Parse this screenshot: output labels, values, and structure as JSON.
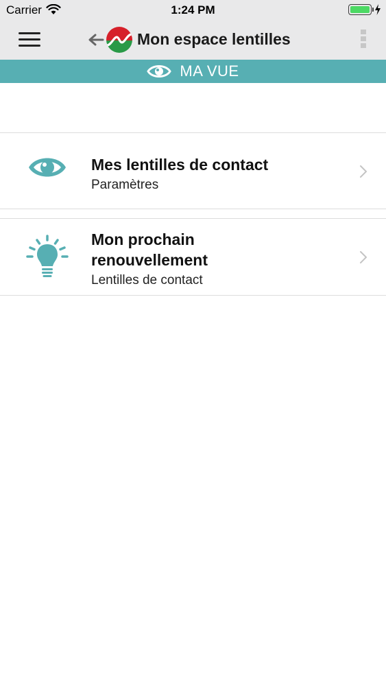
{
  "status_bar": {
    "carrier": "Carrier",
    "time": "1:24 PM",
    "battery_level": 1.0
  },
  "nav": {
    "title": "Mon espace lentilles"
  },
  "section": {
    "title": "MA VUE"
  },
  "items": [
    {
      "title": "Mes lentilles de contact",
      "subtitle": "Paramètres",
      "icon": "eye-icon"
    },
    {
      "title": "Mon prochain renouvellement",
      "subtitle": "Lentilles de contact",
      "icon": "lightbulb-icon"
    }
  ],
  "colors": {
    "accent": "#57afb3",
    "bar_bg": "#e9e9ea",
    "logo_red": "#d6202a",
    "logo_green": "#2a9a47"
  }
}
